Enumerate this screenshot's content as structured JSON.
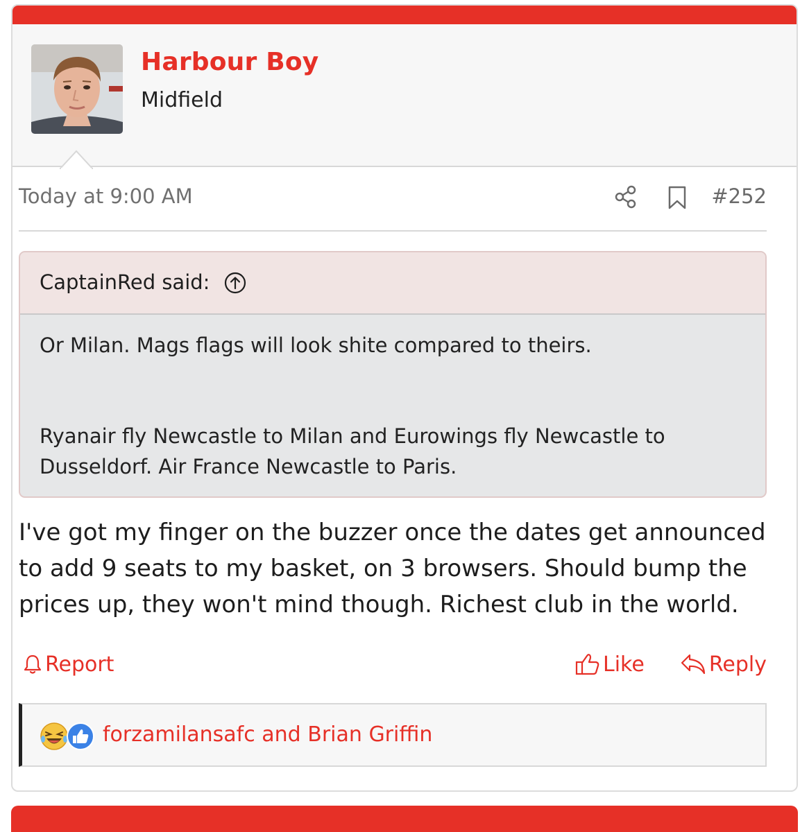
{
  "post": {
    "user": {
      "name": "Harbour Boy",
      "title": "Midfield"
    },
    "meta": {
      "time": "Today at 9:00 AM",
      "number": "#252"
    },
    "quote": {
      "author": "CaptainRed said:",
      "paragraphs": [
        "Or Milan. Mags flags will look shite compared to theirs.",
        "Ryanair fly Newcastle to Milan and Eurowings fly Newcastle to Dusseldorf. Air France Newcastle to Paris."
      ]
    },
    "message": "I've got my finger on the buzzer once the dates get announced to add 9 seats to my basket, on 3 browsers. Should bump the prices up, they won't mind though. Richest club in the world.",
    "actions": {
      "report": "Report",
      "like": "Like",
      "reply": "Reply"
    },
    "reactions": {
      "icons": [
        "laughing-emoji-icon",
        "thumbs-up-icon"
      ],
      "names": "forzamilansafc and Brian Griffin"
    }
  },
  "colors": {
    "accent": "#e63027",
    "text": "#1d1d1d",
    "muted": "#707070",
    "quote_header_bg": "#f1e4e3",
    "quote_body_bg": "#e6e7e8",
    "header_bg": "#f7f7f7"
  }
}
